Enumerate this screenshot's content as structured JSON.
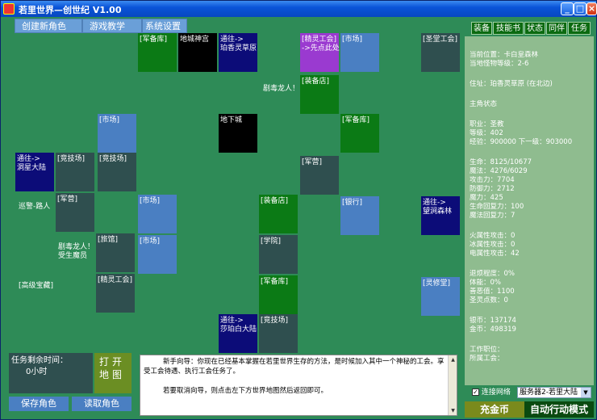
{
  "window": {
    "title": "若里世界—创世纪 V1.00",
    "minimize": "_",
    "maximize": "□",
    "close": "×"
  },
  "menu": {
    "create": "创建新角色",
    "teach": "游戏教学",
    "system": "系统设置"
  },
  "tiles": [
    {
      "id": "armory-top",
      "label": "[军备库]",
      "color": "green"
    },
    {
      "id": "underground-palace",
      "label": "地城神宫",
      "color": "black"
    },
    {
      "id": "portal-baixiang",
      "label": "通往->\n珀香灵草原",
      "color": "navy"
    },
    {
      "id": "spirit-guild",
      "label": "[精灵工会]\n->先点此处",
      "color": "purple"
    },
    {
      "id": "market-top",
      "label": "[市场]",
      "color": "blue"
    },
    {
      "id": "holy-guild",
      "label": "[圣堂工会]",
      "color": "gray"
    },
    {
      "id": "equip-shop-top",
      "label": "[装备店]",
      "color": "green"
    },
    {
      "id": "market-left",
      "label": "[市场]",
      "color": "blue"
    },
    {
      "id": "dungeon",
      "label": "地下城",
      "color": "black"
    },
    {
      "id": "armory-right",
      "label": "[军备库]",
      "color": "green"
    },
    {
      "id": "portal-dongxing",
      "label": "通往->\n洞星大陆",
      "color": "navy"
    },
    {
      "id": "arena-1",
      "label": "[竞技场]",
      "color": "gray"
    },
    {
      "id": "arena-2",
      "label": "[竞技场]",
      "color": "gray"
    },
    {
      "id": "barracks-right",
      "label": "[军营]",
      "color": "gray"
    },
    {
      "id": "barracks-left",
      "label": "[军营]",
      "color": "gray"
    },
    {
      "id": "market-mid",
      "label": "[市场]",
      "color": "blue"
    },
    {
      "id": "equip-shop-mid",
      "label": "[装备店]",
      "color": "green"
    },
    {
      "id": "bank",
      "label": "[银行]",
      "color": "blue"
    },
    {
      "id": "portal-wangjian",
      "label": "通往->\n望涧森林",
      "color": "navy"
    },
    {
      "id": "inn",
      "label": "[旅馆]",
      "color": "gray"
    },
    {
      "id": "market-low",
      "label": "[市场]",
      "color": "blue"
    },
    {
      "id": "academy",
      "label": "[学院]",
      "color": "gray"
    },
    {
      "id": "spirit-guild-2",
      "label": "[精灵工会]",
      "color": "gray"
    },
    {
      "id": "armory-low",
      "label": "[军备库]",
      "color": "green"
    },
    {
      "id": "spirit-hall",
      "label": "[灵修堂]",
      "color": "blue"
    },
    {
      "id": "portal-shabo",
      "label": "通往->\n莎珀白大陆",
      "color": "navy"
    },
    {
      "id": "arena-3",
      "label": "[竞技场]",
      "color": "gray"
    }
  ],
  "map_labels": {
    "dragon_top": "剧毒龙人！",
    "patrol": "巡警-路人",
    "dragon_low": "剧毒龙人！\n受生魔员",
    "treasure": "[高级宝藏]"
  },
  "side_tabs": [
    "装备",
    "技能书",
    "状态",
    "同伴",
    "任务"
  ],
  "status": {
    "location": "当前位置：卡白皇森林",
    "monster_level": "当地怪物等级：2-6",
    "residence": "住址：珀香灵草原 (在北边)",
    "section_title": "主角状态",
    "job": "职业：圣教",
    "level": "等级：402",
    "exp": "经验：900000  下一级：903000",
    "hp": "生命：8125/10677",
    "mp": "魔法：4276/6029",
    "attack": "攻击力：7704",
    "defense": "防御力：2712",
    "magic": "魔力：425",
    "hp_regen": "生命回复力：100",
    "mp_regen": "魔法回复力：7",
    "fire_atk": "火属性攻击：0",
    "ice_atk": "冰属性攻击：0",
    "elec_atk": "电属性攻击：42",
    "fatigue": "退烦程度：0%",
    "stamina": "体能：0%",
    "reputation": "善恶值：1100",
    "spirit_points": "圣灵点数：0",
    "silver": "银币：137174",
    "gold": "金币：498319",
    "work_position": "工作职位：",
    "guild": "所属工会："
  },
  "timer": {
    "label": "任务剩余时间：",
    "value": "0小时"
  },
  "open_map": "打开地图",
  "buttons": {
    "save": "保存角色",
    "load": "读取角色",
    "charge": "充金币",
    "auto": "自动行动模式"
  },
  "message": {
    "line1": "新手向导：你现在已经基本掌握在若里世界生存的方法，是时候加入其中一个神秘的工会。享受工会待遇、执行工会任务了。",
    "line2": "若要取消向导，则点击左下方世界地图然后返回即可。"
  },
  "net": {
    "label": "连接网络",
    "checked": "✓"
  },
  "server": {
    "selected": "服务器2-若里大陆"
  },
  "colors": {
    "bg": "#2e8b57",
    "green": "#0b7a15",
    "blue": "#4a7fc2",
    "navy": "#0c0c78",
    "gray": "#2f4f4f",
    "purple": "#9a3ad0",
    "panel": "#8fbc8f"
  }
}
